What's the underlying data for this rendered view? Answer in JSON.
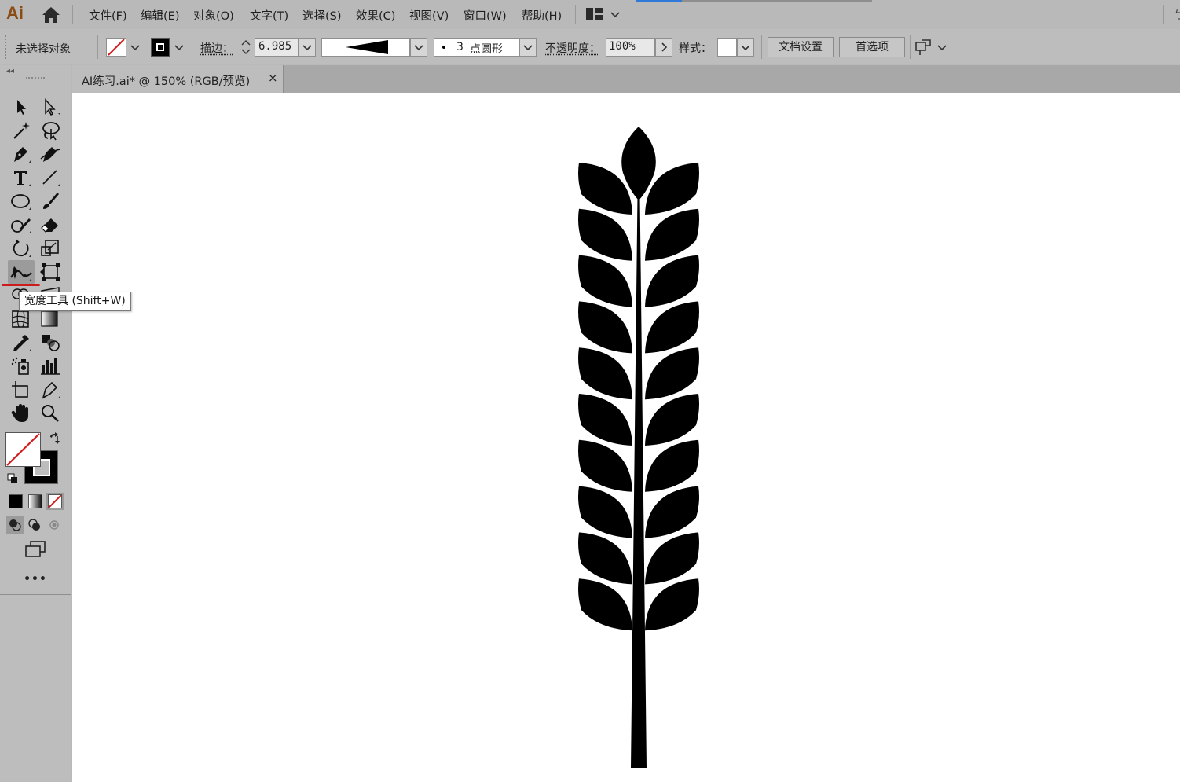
{
  "app": {
    "logo_text": "Ai",
    "right_edge_char": "ㄅ"
  },
  "menu": {
    "items": [
      "文件(F)",
      "编辑(E)",
      "对象(O)",
      "文字(T)",
      "选择(S)",
      "效果(C)",
      "视图(V)",
      "窗口(W)",
      "帮助(H)"
    ]
  },
  "control_bar": {
    "selection_status": "未选择对象",
    "stroke_label": "描边：",
    "stroke_weight": "6.985",
    "brush_size": "3",
    "brush_shape": "点圆形",
    "opacity_label": "不透明度：",
    "opacity_value": "100%",
    "style_label": "样式：",
    "doc_setup_button": "文档设置",
    "preferences_button": "首选项"
  },
  "document": {
    "tab_title": "AI练习.ai* @ 150% (RGB/预览)",
    "close_glyph": "×"
  },
  "tools": {
    "active_tool": "width-tool",
    "tooltip": "宽度工具 (Shift+W)",
    "more_glyph": "•••"
  },
  "colors": {
    "fill": "none",
    "stroke": "#000000",
    "highlight_underline": "#cc1b1b",
    "accent_blue": "#2f7ad8",
    "artwork": "#000000"
  },
  "artwork": {
    "description_icon": "wheat-ear",
    "leaf_pairs": 10
  }
}
